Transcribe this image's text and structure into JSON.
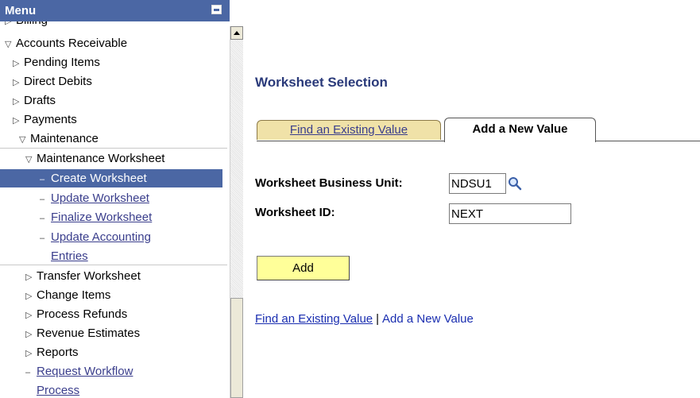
{
  "menu": {
    "title": "Menu",
    "items": [
      {
        "label": "Billing",
        "marker": "▷"
      },
      {
        "label": "Accounts Receivable",
        "marker": "▽"
      },
      {
        "label": "Pending Items",
        "marker": "▷"
      },
      {
        "label": "Direct Debits",
        "marker": "▷"
      },
      {
        "label": "Drafts",
        "marker": "▷"
      },
      {
        "label": "Payments",
        "marker": "▷"
      },
      {
        "label": "Maintenance",
        "marker": "▽"
      },
      {
        "label": "Maintenance Worksheet",
        "marker": "▽"
      },
      {
        "label": "Create Worksheet",
        "marker": "–"
      },
      {
        "label": "Update Worksheet",
        "marker": "–"
      },
      {
        "label": "Finalize Worksheet",
        "marker": "–"
      },
      {
        "label": "Update Accounting",
        "marker": "–"
      },
      {
        "label": "Entries",
        "marker": ""
      },
      {
        "label": "Transfer Worksheet",
        "marker": "▷"
      },
      {
        "label": "Change Items",
        "marker": "▷"
      },
      {
        "label": "Process Refunds",
        "marker": "▷"
      },
      {
        "label": "Revenue Estimates",
        "marker": "▷"
      },
      {
        "label": "Reports",
        "marker": "▷"
      },
      {
        "label": "Request Workflow",
        "marker": "–"
      },
      {
        "label": "Process",
        "marker": ""
      }
    ]
  },
  "page": {
    "title": "Worksheet Selection",
    "tabs": [
      {
        "label": "Find an Existing Value"
      },
      {
        "label": "Add a New Value"
      }
    ],
    "fields": {
      "business_unit_label": "Worksheet Business Unit:",
      "business_unit_value": "NDSU1",
      "worksheet_id_label": "Worksheet ID:",
      "worksheet_id_value": "NEXT"
    },
    "add_button": "Add",
    "links": {
      "find_existing": "Find an Existing Value",
      "separator": "|",
      "add_new": "Add a New Value"
    }
  },
  "colors": {
    "menu_header": "#4b67a4",
    "selected_item": "#4b67a4",
    "title_text": "#2a3a7a",
    "inactive_tab": "#f0e2a8",
    "add_button": "#ffff99"
  },
  "icons": {
    "collapse": "minus-icon",
    "lookup": "magnifier-icon",
    "scroll_up": "up-arrow-icon"
  }
}
